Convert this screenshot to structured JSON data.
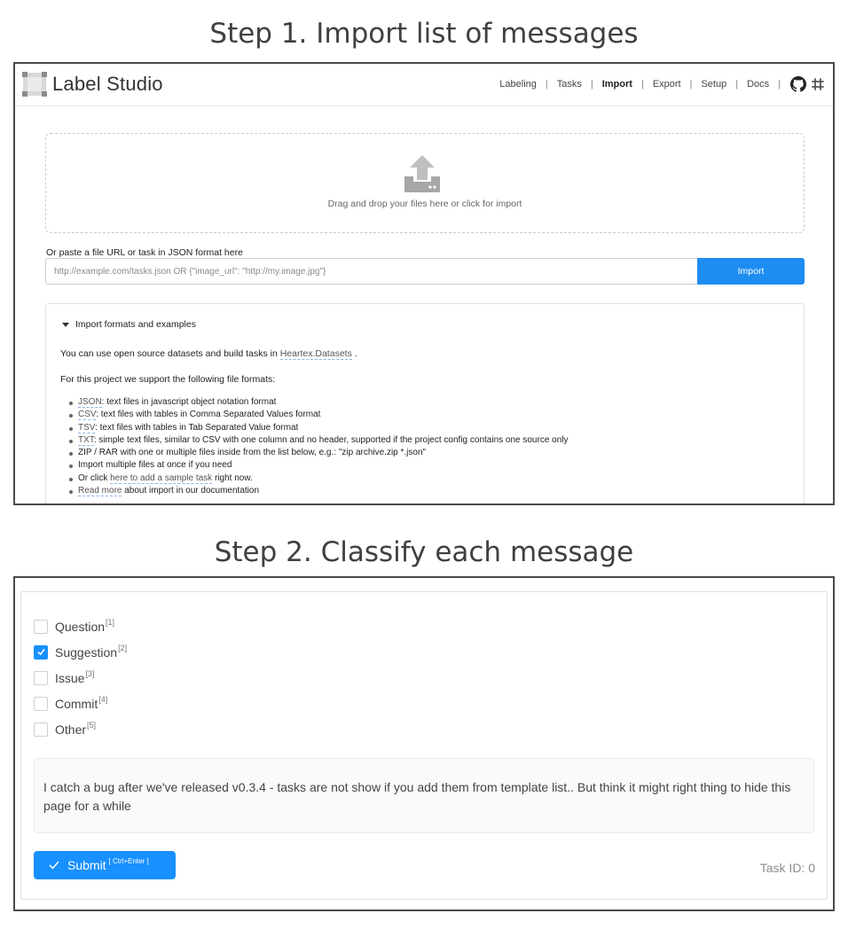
{
  "step1": {
    "title": "Step 1. Import list of messages"
  },
  "step2": {
    "title": "Step 2. Classify each message"
  },
  "app": {
    "name": "Label Studio"
  },
  "nav": {
    "items": [
      "Labeling",
      "Tasks",
      "Import",
      "Export",
      "Setup",
      "Docs"
    ],
    "active": "Import",
    "icons": [
      "github-icon",
      "slack-icon"
    ]
  },
  "dropzone": {
    "text": "Drag and drop your files here or click for import"
  },
  "paste": {
    "label": "Or paste a file URL or task in JSON format here",
    "placeholder": "http://example.com/tasks.json OR {\"image_url\": \"http://my.image.jpg\"}",
    "button": "Import"
  },
  "formats": {
    "heading": "Import formats and examples",
    "datasets_pre": "You can use open source datasets and build tasks in ",
    "datasets_link": "Heartex.Datasets",
    "datasets_post": " .",
    "support_text": "For this project we support the following file formats:",
    "items": [
      {
        "link": "JSON",
        "text": ": text files in javascript object notation format"
      },
      {
        "link": "CSV",
        "text": ": text files with tables in Comma Separated Values format"
      },
      {
        "link": "TSV",
        "text": ": text files with tables in Tab Separated Value format"
      },
      {
        "link": "TXT",
        "text": ": simple text files, similar to CSV with one column and no header, supported if the project config contains one source only"
      },
      {
        "link": "",
        "text": "ZIP / RAR with one or multiple files inside from the list below, e.g.: \"zip archive.zip *.json\""
      },
      {
        "link": "",
        "text": "Import multiple files at once if you need"
      },
      {
        "pre": "Or click ",
        "link": "here to add a sample task",
        "text": " right now."
      },
      {
        "link": "Read more",
        "text": " about import in our documentation"
      }
    ]
  },
  "choices": [
    {
      "label": "Question",
      "hotkey": "[1]",
      "checked": false
    },
    {
      "label": "Suggestion",
      "hotkey": "[2]",
      "checked": true
    },
    {
      "label": "Issue",
      "hotkey": "[3]",
      "checked": false
    },
    {
      "label": "Commit",
      "hotkey": "[4]",
      "checked": false
    },
    {
      "label": "Other",
      "hotkey": "[5]",
      "checked": false
    }
  ],
  "message": {
    "text": "I catch a bug after we've released v0.3.4 - tasks are not show if you add them from template list.. But think it might right thing to hide this page for a while"
  },
  "submit": {
    "label": "Submit",
    "hotkey": "[ Ctrl+Enter ]"
  },
  "task": {
    "id_text": "Task ID: 0"
  },
  "colors": {
    "primary": "#1890ff",
    "import_button": "#1e8df1"
  }
}
